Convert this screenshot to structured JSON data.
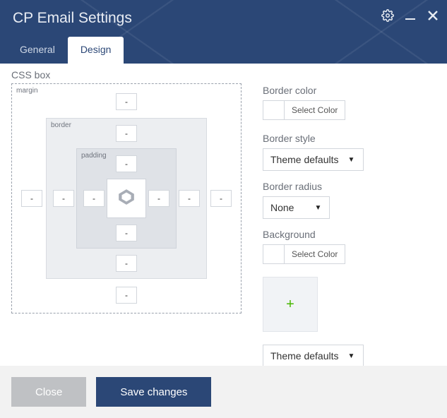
{
  "header": {
    "title": "CP Email Settings",
    "tabs": [
      {
        "label": "General",
        "active": false
      },
      {
        "label": "Design",
        "active": true
      }
    ]
  },
  "cssbox": {
    "section_label": "CSS box",
    "labels": {
      "margin": "margin",
      "border": "border",
      "padding": "padding"
    },
    "margin": {
      "top": "-",
      "right": "-",
      "bottom": "-",
      "left": "-"
    },
    "border": {
      "top": "-",
      "right": "-",
      "bottom": "-",
      "left": "-"
    },
    "padding": {
      "top": "-",
      "right": "-",
      "bottom": "-",
      "left": "-"
    }
  },
  "panel": {
    "border_color": {
      "label": "Border color",
      "button": "Select Color"
    },
    "border_style": {
      "label": "Border style",
      "selected": "Theme defaults"
    },
    "border_radius": {
      "label": "Border radius",
      "selected": "None"
    },
    "background": {
      "label": "Background",
      "button": "Select Color"
    },
    "add_background": {
      "icon": "+"
    },
    "font_family": {
      "selected": "Theme defaults"
    }
  },
  "footer": {
    "close": "Close",
    "save": "Save changes"
  }
}
